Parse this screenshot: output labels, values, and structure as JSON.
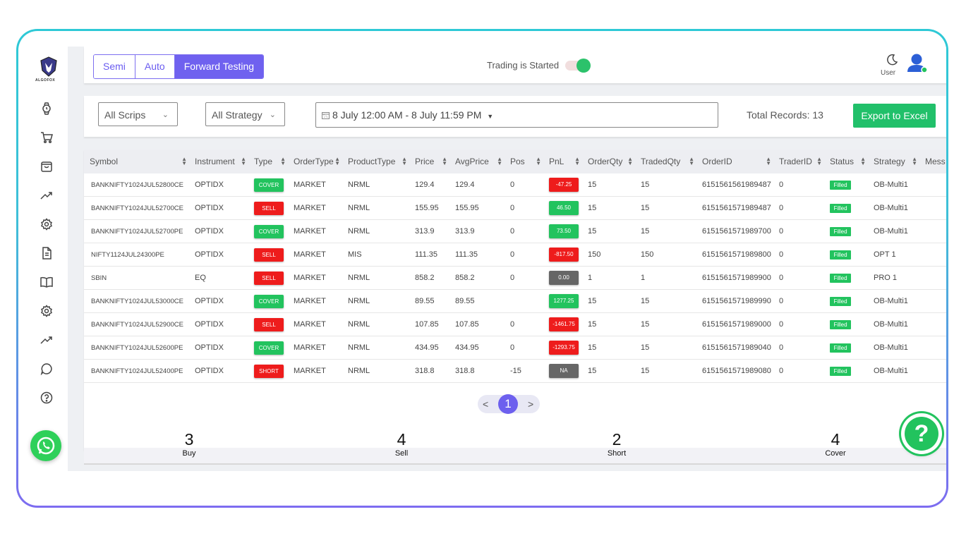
{
  "app": {
    "logo_text": "ALGOFOX"
  },
  "mode_tabs": [
    {
      "label": "Semi",
      "active": false
    },
    {
      "label": "Auto",
      "active": false
    },
    {
      "label": "Forward Testing",
      "active": true
    }
  ],
  "trading": {
    "status_text": "Trading is Started",
    "toggle_on": true
  },
  "user": {
    "label": "User",
    "online": true
  },
  "filters": {
    "scrips": "All Scrips",
    "strategy": "All Strategy",
    "date_range": "8 July 12:00 AM - 8 July 11:59 PM",
    "total_records": "Total Records: 13",
    "export_label": "Export to Excel"
  },
  "table": {
    "columns": [
      "Symbol",
      "Instrument",
      "Type",
      "OrderType",
      "ProductType",
      "Price",
      "AvgPrice",
      "Pos",
      "PnL",
      "OrderQty",
      "TradedQty",
      "OrderID",
      "TraderID",
      "Status",
      "Strategy",
      "Mess"
    ],
    "rows": [
      {
        "symbol": "BANKNIFTY1024JUL52800CE",
        "instrument": "OPTIDX",
        "type": "COVER",
        "ordertype": "MARKET",
        "product": "NRML",
        "price": "129.4",
        "avg": "129.4",
        "pos": "0",
        "pnl": "-47.25",
        "pnl_color": "#ee1c1c",
        "oqty": "15",
        "tqty": "15",
        "orderid": "6151561561989487",
        "traderid": "0",
        "status": "Filled",
        "strategy": "OB-Multi1"
      },
      {
        "symbol": "BANKNIFTY1024JUL52700CE",
        "instrument": "OPTIDX",
        "type": "SELL",
        "ordertype": "MARKET",
        "product": "NRML",
        "price": "155.95",
        "avg": "155.95",
        "pos": "0",
        "pnl": "46.50",
        "pnl_color": "#22c35e",
        "oqty": "15",
        "tqty": "15",
        "orderid": "6151561571989487",
        "traderid": "0",
        "status": "Filled",
        "strategy": "OB-Multi1"
      },
      {
        "symbol": "BANKNIFTY1024JUL52700PE",
        "instrument": "OPTIDX",
        "type": "COVER",
        "ordertype": "MARKET",
        "product": "NRML",
        "price": "313.9",
        "avg": "313.9",
        "pos": "0",
        "pnl": "73.50",
        "pnl_color": "#22c35e",
        "oqty": "15",
        "tqty": "15",
        "orderid": "6151561571989700",
        "traderid": "0",
        "status": "Filled",
        "strategy": "OB-Multi1"
      },
      {
        "symbol": "NIFTY1124JUL24300PE",
        "instrument": "OPTIDX",
        "type": "SELL",
        "ordertype": "MARKET",
        "product": "MIS",
        "price": "111.35",
        "avg": "111.35",
        "pos": "0",
        "pnl": "-817.50",
        "pnl_color": "#ee1c1c",
        "oqty": "150",
        "tqty": "150",
        "orderid": "6151561571989800",
        "traderid": "0",
        "status": "Filled",
        "strategy": "OPT 1"
      },
      {
        "symbol": "SBIN",
        "instrument": "EQ",
        "type": "SELL",
        "ordertype": "MARKET",
        "product": "NRML",
        "price": "858.2",
        "avg": "858.2",
        "pos": "0",
        "pnl": "0.00",
        "pnl_color": "#666666",
        "oqty": "1",
        "tqty": "1",
        "orderid": "6151561571989900",
        "traderid": "0",
        "status": "Filled",
        "strategy": "PRO 1"
      },
      {
        "symbol": "BANKNIFTY1024JUL53000CE",
        "instrument": "OPTIDX",
        "type": "COVER",
        "ordertype": "MARKET",
        "product": "NRML",
        "price": "89.55",
        "avg": "89.55",
        "pos": "",
        "pnl": "1277.25",
        "pnl_color": "#22c35e",
        "oqty": "15",
        "tqty": "15",
        "orderid": "6151561571989990",
        "traderid": "0",
        "status": "Filled",
        "strategy": "OB-Multi1"
      },
      {
        "symbol": "BANKNIFTY1024JUL52900CE",
        "instrument": "OPTIDX",
        "type": "SELL",
        "ordertype": "MARKET",
        "product": "NRML",
        "price": "107.85",
        "avg": "107.85",
        "pos": "0",
        "pnl": "-1461.75",
        "pnl_color": "#ee1c1c",
        "oqty": "15",
        "tqty": "15",
        "orderid": "6151561571989000",
        "traderid": "0",
        "status": "Filled",
        "strategy": "OB-Multi1"
      },
      {
        "symbol": "BANKNIFTY1024JUL52600PE",
        "instrument": "OPTIDX",
        "type": "COVER",
        "ordertype": "MARKET",
        "product": "NRML",
        "price": "434.95",
        "avg": "434.95",
        "pos": "0",
        "pnl": "-1293.75",
        "pnl_color": "#ee1c1c",
        "oqty": "15",
        "tqty": "15",
        "orderid": "6151561571989040",
        "traderid": "0",
        "status": "Filled",
        "strategy": "OB-Multi1"
      },
      {
        "symbol": "BANKNIFTY1024JUL52400PE",
        "instrument": "OPTIDX",
        "type": "SHORT",
        "ordertype": "MARKET",
        "product": "NRML",
        "price": "318.8",
        "avg": "318.8",
        "pos": "-15",
        "pnl": "NA",
        "pnl_color": "#666666",
        "oqty": "15",
        "tqty": "15",
        "orderid": "6151561571989080",
        "traderid": "0",
        "status": "Filled",
        "strategy": "OB-Multi1"
      }
    ]
  },
  "type_colors": {
    "COVER": "#22c35e",
    "SELL": "#ee1c1c",
    "SHORT": "#ee1c1c",
    "BUY": "#22c35e"
  },
  "pagination": {
    "prev": "<",
    "current": "1",
    "next": ">"
  },
  "summary": [
    {
      "count": "3",
      "label": "Buy"
    },
    {
      "count": "4",
      "label": "Sell"
    },
    {
      "count": "2",
      "label": "Short"
    },
    {
      "count": "4",
      "label": "Cover"
    }
  ],
  "help_glyph": "?"
}
